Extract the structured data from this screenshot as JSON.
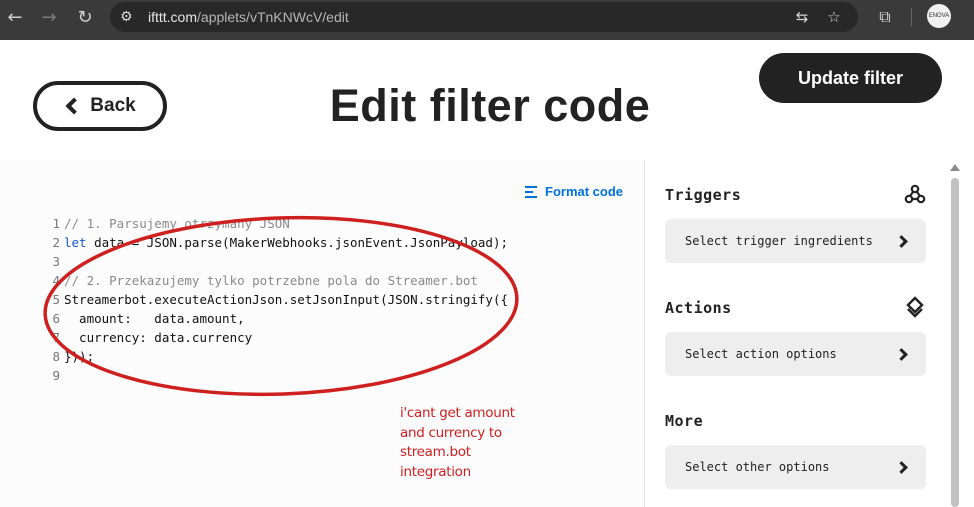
{
  "browser": {
    "url_host": "ifttt.com",
    "url_path": "/applets/vTnKNWcV/edit",
    "back_icon": "←",
    "forward_icon": "→",
    "reload_icon": "↻",
    "site_info_icon": "⚙",
    "translate_icon": "⇆",
    "star_icon": "☆",
    "extensions_icon": "⧉",
    "profile_label": "ENOVA"
  },
  "page": {
    "back_label": "Back",
    "title": "Edit filter code",
    "update_label": "Update filter"
  },
  "editor": {
    "format_label": "Format code",
    "lines": [
      {
        "num": "1",
        "text": "// 1. Parsujemy otrzymany JSON",
        "comment": true
      },
      {
        "num": "2",
        "text": "let data = JSON.parse(MakerWebhooks.jsonEvent.JsonPayload);",
        "comment": false
      },
      {
        "num": "3",
        "text": "",
        "comment": false
      },
      {
        "num": "4",
        "text": "// 2. Przekazujemy tylko potrzebne pola do Streamer.bot",
        "comment": true
      },
      {
        "num": "5",
        "text": "Streamerbot.executeActionJson.setJsonInput(JSON.stringify({",
        "comment": false
      },
      {
        "num": "6",
        "text": "  amount:   data.amount,",
        "comment": false
      },
      {
        "num": "7",
        "text": "  currency: data.currency",
        "comment": false
      },
      {
        "num": "8",
        "text": "}));",
        "comment": false
      },
      {
        "num": "9",
        "text": "",
        "comment": false
      }
    ],
    "annotation_note": "i'cant get amount and currency to stream.bot integration"
  },
  "sidebar": {
    "triggers": {
      "heading": "Triggers",
      "button": "Select trigger ingredients",
      "icon": "webhooks-icon"
    },
    "actions": {
      "heading": "Actions",
      "button": "Select action options",
      "icon": "diamond-icon"
    },
    "more": {
      "heading": "More",
      "button": "Select other options"
    }
  },
  "colors": {
    "chrome_bg": "#3a3a3a",
    "dark": "#222222",
    "link_blue": "#0070e0",
    "annotation_red": "#cf2020"
  }
}
